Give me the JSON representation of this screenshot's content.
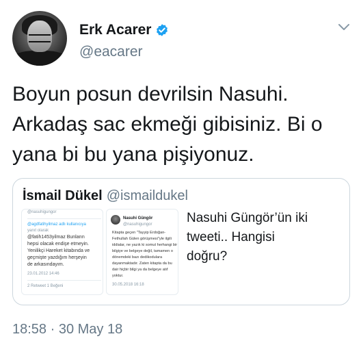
{
  "tweet": {
    "author": {
      "display_name": "Erk Acarer",
      "handle": "@eacarer",
      "verified": true
    },
    "text_lines": [
      "Boyun posun devrilsin Nasuhi.",
      "Arkadaş sac ekmeği gibisiniz. Bi o",
      "yana bi bu yana pişiyonuz."
    ],
    "timestamp": "18:58 · 30 May 18",
    "menu_icon": "chevron-down-icon"
  },
  "quoted_tweet": {
    "display_name": "İsmail Dükel",
    "handle": "@ismaildukel",
    "text_lines": [
      "Nasuhi Güngör’ün iki",
      "tweeti.. Hangisi",
      "doğru?"
    ],
    "image_left": {
      "top_handle": "@nasuhigungor",
      "reply_context": "@agdfatihyilmaz adlı kullanıcıya",
      "reply_label": "yanıt olarak",
      "body_lines": [
        "@fatih1453yilmaz Bunların",
        "hepsi olacak endişe etmeyin.",
        "Yenilikçi Hareket kitabında ve",
        "geçmişte yazdığım herşeyin",
        "de arkasındayım."
      ],
      "date": "23.01.2012 14:46",
      "stats": "2 Retweet 1 Beğeni"
    },
    "image_right": {
      "name": "Nasuhi Güngör",
      "handle": "@nasuhigungor",
      "body_lines": [
        "Kitapta geçen \"Tayyip Erdoğan-",
        "Fethullah Gülen görüşmesi\"yle ilgili",
        "iddialar, ne yazık ki somut herhangi bir",
        "bilgiye ve belgeye değil, tamamen o",
        "dönemdeki bazı dedikodulara",
        "dayanmaktadır. Zaten kitapta da bu",
        "dair hiçbir bilgi ya da belgeye atıf",
        "yoktur."
      ],
      "date": "30.05.2018 16:18"
    }
  },
  "colors": {
    "text": "#14171a",
    "secondary": "#657786",
    "verified_blue": "#1da1f2",
    "border": "#ccd6dd"
  }
}
